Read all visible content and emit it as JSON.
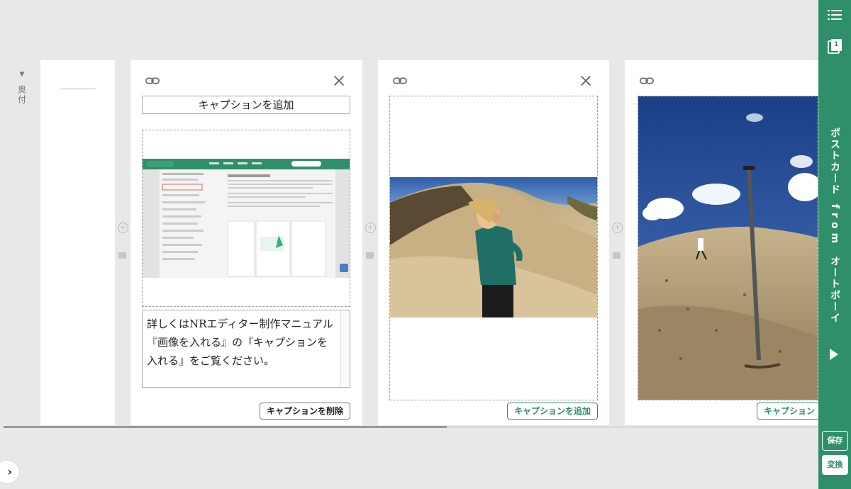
{
  "left_marker": {
    "arrow": "▼",
    "label": "奥付"
  },
  "pages": [
    {
      "caption_placeholder": "キャプションを追加",
      "caption_text": "詳しくはNRエディター制作マニュアル『画像を入れる』の『キャプションを入れる』をご覧ください。",
      "caption_button": "キャプションを削除"
    },
    {
      "caption_button": "キャプションを追加"
    },
    {
      "caption_button": "キャプション"
    }
  ],
  "sidebar": {
    "page_count": "1",
    "title_parts": [
      "ポストカード",
      "from",
      "オートボーイ"
    ],
    "save_label": "保存",
    "convert_label": "変換"
  },
  "icons": {
    "link": "link-icon",
    "close": "close-icon",
    "menu": "list-menu-icon",
    "pages": "pages-icon",
    "play": "play-icon",
    "expand": "chevron-right-icon"
  },
  "colors": {
    "accent": "#2f8f6a",
    "background": "#e8e8e8"
  }
}
